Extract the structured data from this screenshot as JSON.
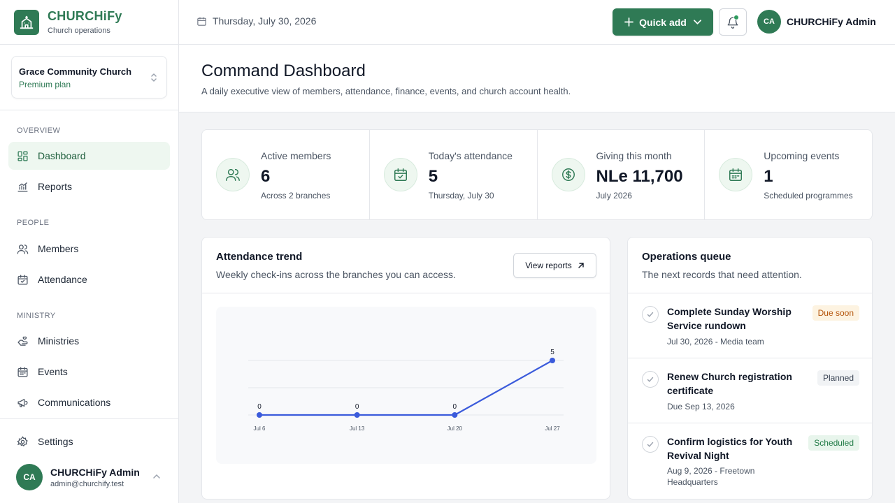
{
  "brand": {
    "name": "CHURCHiFy",
    "subtitle": "Church operations"
  },
  "church": {
    "name": "Grace Community Church",
    "plan": "Premium plan"
  },
  "sidebar": {
    "sections": {
      "overview": "OVERVIEW",
      "people": "PEOPLE",
      "ministry": "MINISTRY"
    },
    "items": {
      "dashboard": "Dashboard",
      "reports": "Reports",
      "members": "Members",
      "attendance": "Attendance",
      "ministries": "Ministries",
      "events": "Events",
      "communications": "Communications",
      "settings": "Settings"
    },
    "user": {
      "initials": "CA",
      "name": "CHURCHiFy Admin",
      "email": "admin@churchify.test"
    }
  },
  "topbar": {
    "date": "Thursday, July 30, 2026",
    "quick_add": "Quick add",
    "user_initials": "CA",
    "user_name": "CHURCHiFy Admin"
  },
  "page": {
    "title": "Command Dashboard",
    "subtitle": "A daily executive view of members, attendance, finance, events, and church account health."
  },
  "kpis": [
    {
      "label": "Active members",
      "value": "6",
      "foot": "Across 2 branches",
      "icon": "users-icon"
    },
    {
      "label": "Today's attendance",
      "value": "5",
      "foot": "Thursday, July 30",
      "icon": "calendar-check-icon"
    },
    {
      "label": "Giving this month",
      "value": "NLe 11,700",
      "foot": "July 2026",
      "icon": "dollar-circle-icon"
    },
    {
      "label": "Upcoming events",
      "value": "1",
      "foot": "Scheduled programmes",
      "icon": "calendar-icon"
    }
  ],
  "attendance_card": {
    "title": "Attendance trend",
    "subtitle": "Weekly check-ins across the branches you can access.",
    "button": "View reports"
  },
  "chart_data": {
    "type": "line",
    "x": [
      "Jul 6",
      "Jul 13",
      "Jul 20",
      "Jul 27"
    ],
    "series": [
      {
        "values": [
          0,
          0,
          0,
          5
        ]
      }
    ],
    "data_labels": [
      "0",
      "0",
      "0",
      "5"
    ],
    "ylim": [
      0,
      5
    ],
    "grid": true,
    "color": "#3b5bdb"
  },
  "ops_card": {
    "title": "Operations queue",
    "subtitle": "The next records that need attention.",
    "items": [
      {
        "title": "Complete Sunday Worship Service rundown",
        "meta": "Jul 30, 2026 - Media team",
        "badge": "Due soon",
        "badge_bg": "#fdf3e1",
        "badge_fg": "#b45309"
      },
      {
        "title": "Renew Church registration certificate",
        "meta": "Due Sep 13, 2026",
        "badge": "Planned",
        "badge_bg": "#f1f3f5",
        "badge_fg": "#374151"
      },
      {
        "title": "Confirm logistics for Youth Revival Night",
        "meta": "Aug 9, 2026 - Freetown Headquarters",
        "badge": "Scheduled",
        "badge_bg": "#e8f5ec",
        "badge_fg": "#1f7a45"
      }
    ]
  },
  "colors": {
    "accent": "#2f7a55",
    "accent_soft": "#eef7f0",
    "line": "#3b5bdb"
  }
}
